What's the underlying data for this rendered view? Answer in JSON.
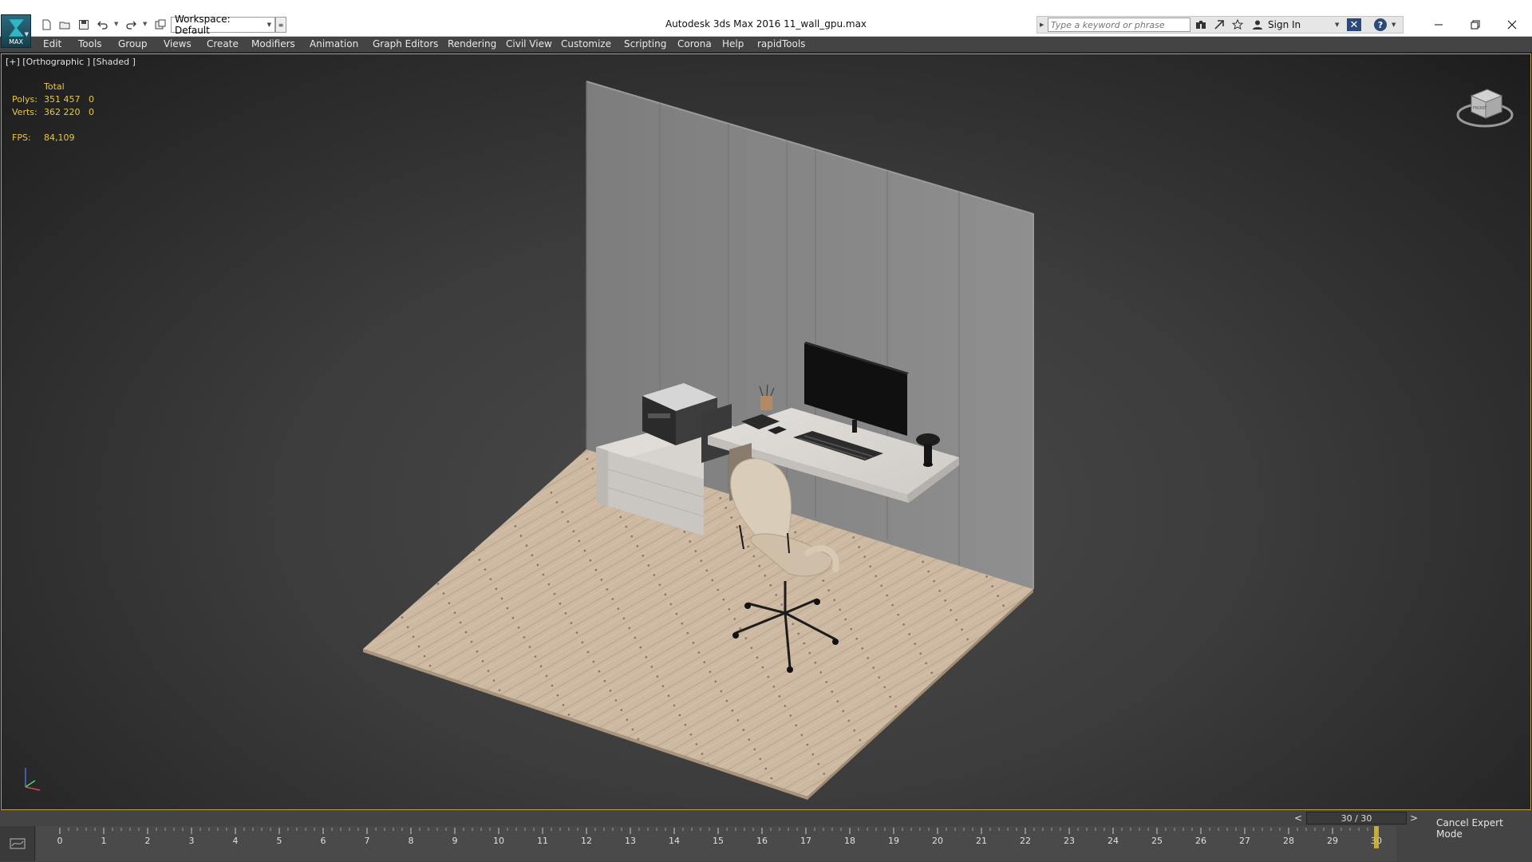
{
  "app": {
    "logo_label": "MAX",
    "window_title": "Autodesk 3ds Max 2016     11_wall_gpu.max"
  },
  "toolbar": {
    "workspace": "Workspace: Default"
  },
  "search": {
    "placeholder": "Type a keyword or phrase"
  },
  "account": {
    "sign_in": "Sign In"
  },
  "help": {
    "label": "?"
  },
  "menu": {
    "items": [
      "Edit",
      "Tools",
      "Group",
      "Views",
      "Create",
      "Modifiers",
      "Animation",
      "Graph Editors",
      "Rendering",
      "Civil View",
      "Customize",
      "Scripting",
      "Corona",
      "Help",
      "rapidTools"
    ]
  },
  "viewport": {
    "label": "[+] [Orthographic ] [Shaded ]",
    "stats": {
      "header": "Total",
      "polys_label": "Polys:",
      "polys_total": "351 457",
      "polys_sel": "0",
      "verts_label": "Verts:",
      "verts_total": "362 220",
      "verts_sel": "0",
      "fps_label": "FPS:",
      "fps_value": "84,109"
    },
    "viewcube_label": "FRONT"
  },
  "timeline": {
    "prev": "<",
    "next": ">",
    "slider": "30 / 30",
    "frames": [
      "0",
      "1",
      "2",
      "3",
      "4",
      "5",
      "6",
      "7",
      "8",
      "9",
      "10",
      "11",
      "12",
      "13",
      "14",
      "15",
      "16",
      "17",
      "18",
      "19",
      "20",
      "21",
      "22",
      "23",
      "24",
      "25",
      "26",
      "27",
      "28",
      "29",
      "30"
    ],
    "current_frame": 30,
    "total_frames": 30
  },
  "status": {
    "cancel_expert": "Cancel Expert Mode"
  }
}
